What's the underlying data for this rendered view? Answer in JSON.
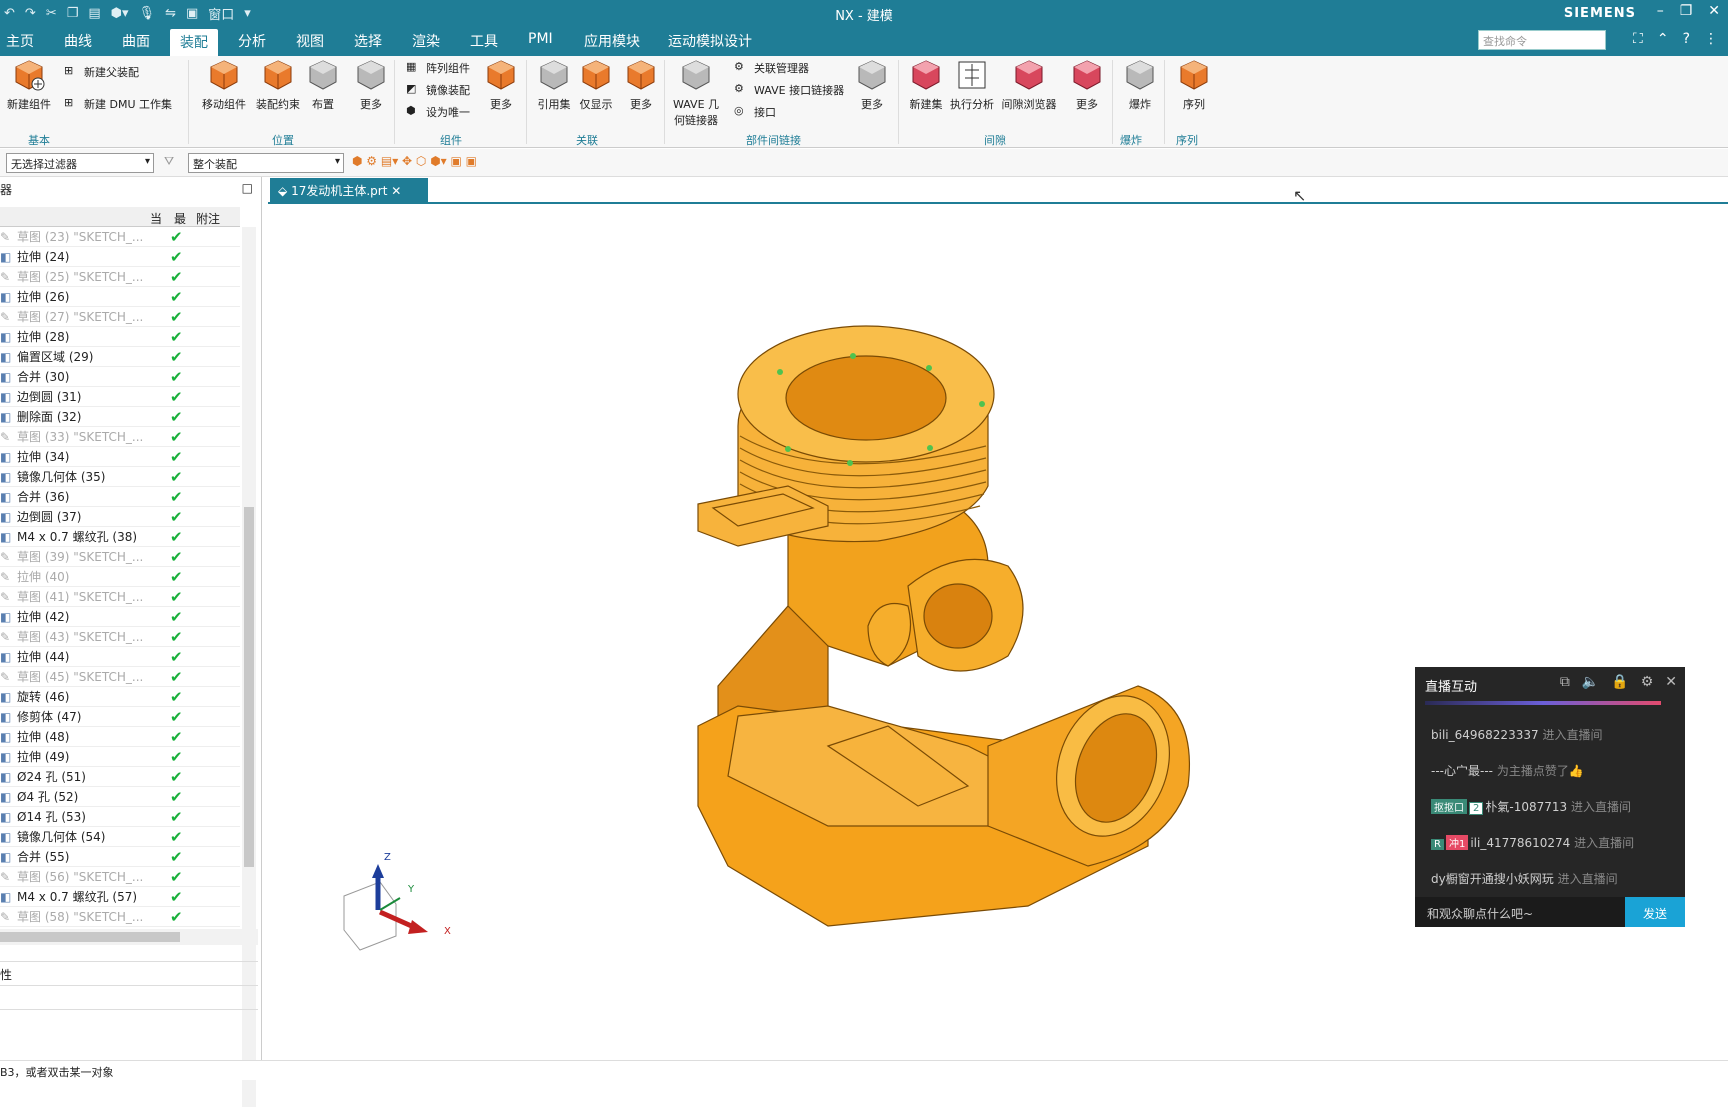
{
  "app": {
    "title": "NX - 建模",
    "brand": "SIEMENS",
    "window_menu": "窗口"
  },
  "menu": {
    "tabs": [
      "主页",
      "曲线",
      "曲面",
      "装配",
      "分析",
      "视图",
      "选择",
      "渲染",
      "工具",
      "PMI",
      "应用模块",
      "运动模拟设计"
    ],
    "active": "装配",
    "search_placeholder": "查找命令"
  },
  "ribbon": {
    "new_component": "新建组件",
    "new_parent_assembly": "新建父装配",
    "new_dmu_workset": "新建 DMU 工作集",
    "group_basic": "基本",
    "move_component": "移动组件",
    "assembly_constraint": "装配约束",
    "layout": "布置",
    "more1": "更多",
    "group_position": "位置",
    "pattern_component": "阵列组件",
    "mirror_assembly": "镜像装配",
    "make_unique": "设为唯一",
    "more2": "更多",
    "group_component": "组件",
    "reference_set": "引用集",
    "show_only": "仅显示",
    "more3": "更多",
    "group_related": "关联",
    "wave_geometry_linker": "WAVE 几\n何链接器",
    "relation_manager": "关联管理器",
    "wave_interface_linker": "WAVE 接口链接器",
    "interface": "接口",
    "more4": "更多",
    "group_interpart": "部件间链接",
    "new_set": "新建集",
    "perform_analysis": "执行分析",
    "clearance_browser": "间隙浏览器",
    "more5": "更多",
    "group_clearance": "间隙",
    "explode": "爆炸",
    "group_explode": "爆炸",
    "sequence": "序列",
    "group_sequence": "序列"
  },
  "filterbar": {
    "selection_filter": "无选择过滤器",
    "scope": "整个装配"
  },
  "navigator": {
    "title_fragment": "器",
    "columns": {
      "current": "当",
      "latest": "最",
      "notes": "附注"
    },
    "rows": [
      {
        "label": "草图 (23) \"SKETCH_...",
        "dim": true
      },
      {
        "label": "拉伸 (24)",
        "dim": false
      },
      {
        "label": "草图 (25) \"SKETCH_...",
        "dim": true
      },
      {
        "label": "拉伸 (26)",
        "dim": false
      },
      {
        "label": "草图 (27) \"SKETCH_...",
        "dim": true
      },
      {
        "label": "拉伸 (28)",
        "dim": false
      },
      {
        "label": "偏置区域 (29)",
        "dim": false
      },
      {
        "label": "合并 (30)",
        "dim": false
      },
      {
        "label": "边倒圆 (31)",
        "dim": false
      },
      {
        "label": "删除面 (32)",
        "dim": false
      },
      {
        "label": "草图 (33) \"SKETCH_...",
        "dim": true
      },
      {
        "label": "拉伸 (34)",
        "dim": false
      },
      {
        "label": "镜像几何体 (35)",
        "dim": false
      },
      {
        "label": "合并 (36)",
        "dim": false
      },
      {
        "label": "边倒圆 (37)",
        "dim": false
      },
      {
        "label": "M4 x 0.7 螺纹孔 (38)",
        "dim": false
      },
      {
        "label": "草图 (39) \"SKETCH_...",
        "dim": true
      },
      {
        "label": "拉伸 (40)",
        "dim": true
      },
      {
        "label": "草图 (41) \"SKETCH_...",
        "dim": true
      },
      {
        "label": "拉伸 (42)",
        "dim": false
      },
      {
        "label": "草图 (43) \"SKETCH_...",
        "dim": true
      },
      {
        "label": "拉伸 (44)",
        "dim": false
      },
      {
        "label": "草图 (45) \"SKETCH_...",
        "dim": true
      },
      {
        "label": "旋转 (46)",
        "dim": false
      },
      {
        "label": "修剪体 (47)",
        "dim": false
      },
      {
        "label": "拉伸 (48)",
        "dim": false
      },
      {
        "label": "拉伸 (49)",
        "dim": false
      },
      {
        "label": "Ø24 孔 (51)",
        "dim": false
      },
      {
        "label": "Ø4 孔 (52)",
        "dim": false
      },
      {
        "label": "Ø14 孔 (53)",
        "dim": false
      },
      {
        "label": "镜像几何体 (54)",
        "dim": false
      },
      {
        "label": "合并 (55)",
        "dim": false
      },
      {
        "label": "草图 (56) \"SKETCH_...",
        "dim": true
      },
      {
        "label": "M4 x 0.7 螺纹孔 (57)",
        "dim": false
      },
      {
        "label": "草图 (58) \"SKETCH_...",
        "dim": true
      }
    ],
    "props_fragment": "性"
  },
  "document_tab": "17发动机主体.prt",
  "triad": {
    "z": "Z",
    "y": "Y",
    "x": "X"
  },
  "status": "B3，或者双击某一对象",
  "live_chat": {
    "title": "直播互动",
    "messages": [
      {
        "badge": "",
        "badge_n": "",
        "name": "bili_64968223337",
        "note": "进入直播间"
      },
      {
        "badge": "",
        "badge_n": "",
        "name": "---心宀最---",
        "note": "为主播点赞了👍"
      },
      {
        "badge": "抠抠口",
        "badge_n": "2",
        "name": "朴氣-1087713",
        "note": "进入直播间"
      },
      {
        "badge": "R",
        "badge_n": "冲1",
        "name": "ili_41778610274",
        "note": "进入直播间"
      },
      {
        "badge": "",
        "badge_n": "",
        "name": "dy橱窗开通搜小妖网玩",
        "note": "进入直播间"
      }
    ],
    "input_placeholder": "和观众聊点什么吧~",
    "send": "发送"
  },
  "colors": {
    "accent": "#1f7d96",
    "part": "#f5a21b",
    "check": "#19b03a"
  }
}
